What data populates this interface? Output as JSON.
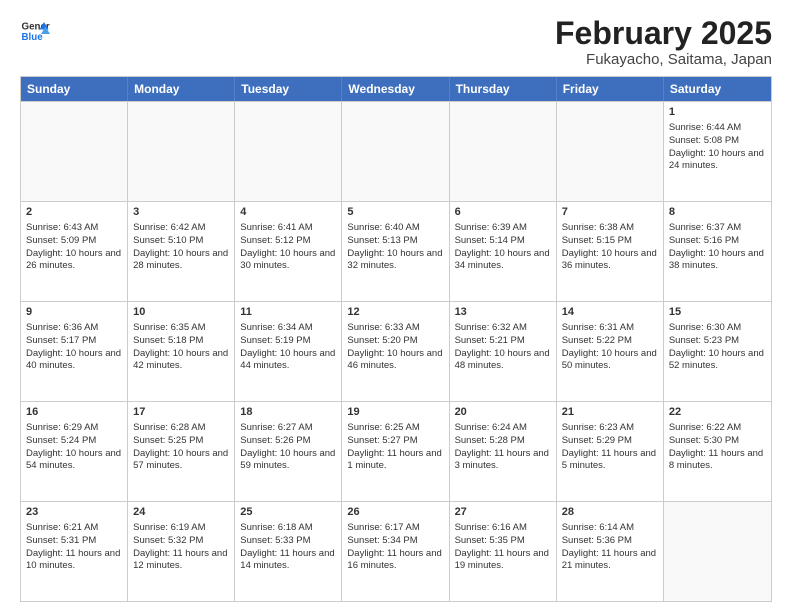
{
  "logo": {
    "line1": "General",
    "line2": "Blue"
  },
  "title": "February 2025",
  "subtitle": "Fukayacho, Saitama, Japan",
  "days_of_week": [
    "Sunday",
    "Monday",
    "Tuesday",
    "Wednesday",
    "Thursday",
    "Friday",
    "Saturday"
  ],
  "weeks": [
    [
      {
        "day": "",
        "data": ""
      },
      {
        "day": "",
        "data": ""
      },
      {
        "day": "",
        "data": ""
      },
      {
        "day": "",
        "data": ""
      },
      {
        "day": "",
        "data": ""
      },
      {
        "day": "",
        "data": ""
      },
      {
        "day": "1",
        "data": "Sunrise: 6:44 AM\nSunset: 5:08 PM\nDaylight: 10 hours and 24 minutes."
      }
    ],
    [
      {
        "day": "2",
        "data": "Sunrise: 6:43 AM\nSunset: 5:09 PM\nDaylight: 10 hours and 26 minutes."
      },
      {
        "day": "3",
        "data": "Sunrise: 6:42 AM\nSunset: 5:10 PM\nDaylight: 10 hours and 28 minutes."
      },
      {
        "day": "4",
        "data": "Sunrise: 6:41 AM\nSunset: 5:12 PM\nDaylight: 10 hours and 30 minutes."
      },
      {
        "day": "5",
        "data": "Sunrise: 6:40 AM\nSunset: 5:13 PM\nDaylight: 10 hours and 32 minutes."
      },
      {
        "day": "6",
        "data": "Sunrise: 6:39 AM\nSunset: 5:14 PM\nDaylight: 10 hours and 34 minutes."
      },
      {
        "day": "7",
        "data": "Sunrise: 6:38 AM\nSunset: 5:15 PM\nDaylight: 10 hours and 36 minutes."
      },
      {
        "day": "8",
        "data": "Sunrise: 6:37 AM\nSunset: 5:16 PM\nDaylight: 10 hours and 38 minutes."
      }
    ],
    [
      {
        "day": "9",
        "data": "Sunrise: 6:36 AM\nSunset: 5:17 PM\nDaylight: 10 hours and 40 minutes."
      },
      {
        "day": "10",
        "data": "Sunrise: 6:35 AM\nSunset: 5:18 PM\nDaylight: 10 hours and 42 minutes."
      },
      {
        "day": "11",
        "data": "Sunrise: 6:34 AM\nSunset: 5:19 PM\nDaylight: 10 hours and 44 minutes."
      },
      {
        "day": "12",
        "data": "Sunrise: 6:33 AM\nSunset: 5:20 PM\nDaylight: 10 hours and 46 minutes."
      },
      {
        "day": "13",
        "data": "Sunrise: 6:32 AM\nSunset: 5:21 PM\nDaylight: 10 hours and 48 minutes."
      },
      {
        "day": "14",
        "data": "Sunrise: 6:31 AM\nSunset: 5:22 PM\nDaylight: 10 hours and 50 minutes."
      },
      {
        "day": "15",
        "data": "Sunrise: 6:30 AM\nSunset: 5:23 PM\nDaylight: 10 hours and 52 minutes."
      }
    ],
    [
      {
        "day": "16",
        "data": "Sunrise: 6:29 AM\nSunset: 5:24 PM\nDaylight: 10 hours and 54 minutes."
      },
      {
        "day": "17",
        "data": "Sunrise: 6:28 AM\nSunset: 5:25 PM\nDaylight: 10 hours and 57 minutes."
      },
      {
        "day": "18",
        "data": "Sunrise: 6:27 AM\nSunset: 5:26 PM\nDaylight: 10 hours and 59 minutes."
      },
      {
        "day": "19",
        "data": "Sunrise: 6:25 AM\nSunset: 5:27 PM\nDaylight: 11 hours and 1 minute."
      },
      {
        "day": "20",
        "data": "Sunrise: 6:24 AM\nSunset: 5:28 PM\nDaylight: 11 hours and 3 minutes."
      },
      {
        "day": "21",
        "data": "Sunrise: 6:23 AM\nSunset: 5:29 PM\nDaylight: 11 hours and 5 minutes."
      },
      {
        "day": "22",
        "data": "Sunrise: 6:22 AM\nSunset: 5:30 PM\nDaylight: 11 hours and 8 minutes."
      }
    ],
    [
      {
        "day": "23",
        "data": "Sunrise: 6:21 AM\nSunset: 5:31 PM\nDaylight: 11 hours and 10 minutes."
      },
      {
        "day": "24",
        "data": "Sunrise: 6:19 AM\nSunset: 5:32 PM\nDaylight: 11 hours and 12 minutes."
      },
      {
        "day": "25",
        "data": "Sunrise: 6:18 AM\nSunset: 5:33 PM\nDaylight: 11 hours and 14 minutes."
      },
      {
        "day": "26",
        "data": "Sunrise: 6:17 AM\nSunset: 5:34 PM\nDaylight: 11 hours and 16 minutes."
      },
      {
        "day": "27",
        "data": "Sunrise: 6:16 AM\nSunset: 5:35 PM\nDaylight: 11 hours and 19 minutes."
      },
      {
        "day": "28",
        "data": "Sunrise: 6:14 AM\nSunset: 5:36 PM\nDaylight: 11 hours and 21 minutes."
      },
      {
        "day": "",
        "data": ""
      }
    ]
  ]
}
